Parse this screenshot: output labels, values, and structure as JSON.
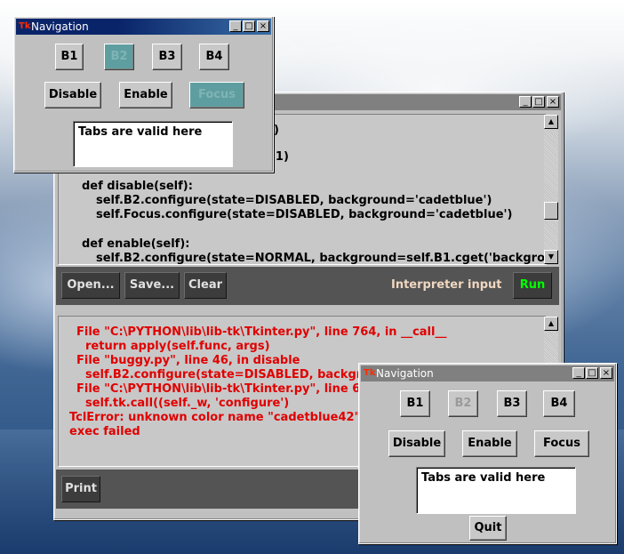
{
  "colors": {
    "title_active": "#0a246a",
    "cadetblue": "#5f9ea0",
    "error_text": "#e00000",
    "toolbar_bg": "#545454",
    "run_text": "#00ff00"
  },
  "nav_top": {
    "title": "Navigation",
    "window_buttons": [
      "_",
      "□",
      "×"
    ],
    "row1": [
      "B1",
      "B2",
      "B3",
      "B4"
    ],
    "row2": [
      "Disable",
      "Enable",
      "Focus"
    ],
    "text_value": "Tabs are valid here"
  },
  "main": {
    "window_buttons": [
      "_",
      "□",
      "×"
    ],
    "code_lines": [
      "1)",
      "=1)",
      "def disable(self):",
      "self.B2.configure(state=DISABLED, background='cadetblue')",
      "self.Focus.configure(state=DISABLED, background='cadetblue')",
      "def enable(self):",
      "self.B2.configure(state=NORMAL, background=self.B1.cget('backgro"
    ],
    "toolbar": {
      "open": "Open...",
      "save": "Save...",
      "clear": "Clear",
      "interpreter_label": "Interpreter input",
      "run": "Run"
    },
    "output_lines": [
      "File \"C:\\PYTHON\\lib\\lib-tk\\Tkinter.py\", line 764, in __call__",
      "return apply(self.func, args)",
      "File \"buggy.py\", line 46, in disable",
      "self.B2.configure(state=DISABLED, backgrou",
      "File \"C:\\PYTHON\\lib\\lib-tk\\Tkinter.py\", line 6",
      "self.tk.call((self._w, 'configure')",
      "TclError: unknown color name \"cadetblue42\"",
      "exec failed"
    ],
    "print": "Print"
  },
  "nav_bottom": {
    "title": "Navigation",
    "window_buttons": [
      "_",
      "□",
      "×"
    ],
    "row1": [
      "B1",
      "B2",
      "B3",
      "B4"
    ],
    "row2": [
      "Disable",
      "Enable",
      "Focus"
    ],
    "text_value": "Tabs are valid here",
    "quit": "Quit"
  },
  "icons": {
    "app_icon": "Tk"
  }
}
